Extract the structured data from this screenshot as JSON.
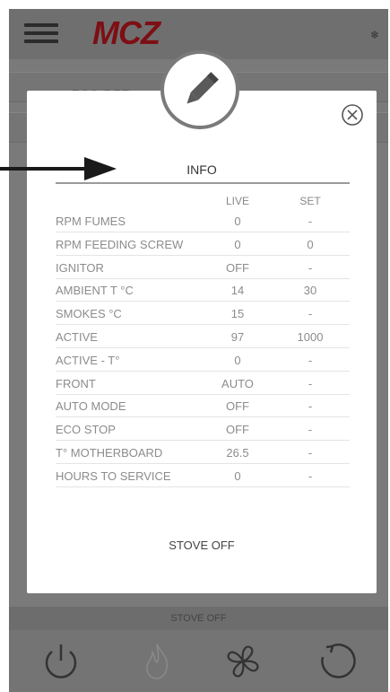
{
  "header": {
    "brand": "MCZ",
    "menu_icon": "hamburger-menu-icon",
    "status_icon": "snowflake-icon"
  },
  "background": {
    "strip_text": "ECO DET",
    "status_text": "STOVE OFF",
    "bottom_icons": [
      "power-icon",
      "flame-icon",
      "fan-icon",
      "refresh-icon"
    ]
  },
  "modal": {
    "badge_icon": "pencil-icon",
    "close_icon": "close-icon",
    "title": "INFO",
    "columns": {
      "live": "LIVE",
      "set": "SET"
    },
    "rows": [
      {
        "label": "RPM FUMES",
        "live": "0",
        "set": "-"
      },
      {
        "label": "RPM FEEDING SCREW",
        "live": "0",
        "set": "0"
      },
      {
        "label": "IGNITOR",
        "live": "OFF",
        "set": "-"
      },
      {
        "label": "AMBIENT T °C",
        "live": "14",
        "set": "30"
      },
      {
        "label": "SMOKES °C",
        "live": "15",
        "set": "-"
      },
      {
        "label": "ACTIVE",
        "live": "97",
        "set": "1000"
      },
      {
        "label": "ACTIVE - T°",
        "live": "0",
        "set": "-"
      },
      {
        "label": "FRONT",
        "live": "AUTO",
        "set": "-"
      },
      {
        "label": "AUTO MODE",
        "live": "OFF",
        "set": "-"
      },
      {
        "label": "ECO STOP",
        "live": "OFF",
        "set": "-"
      },
      {
        "label": "T° MOTHERBOARD",
        "live": "26.5",
        "set": "-"
      },
      {
        "label": "HOURS TO SERVICE",
        "live": "0",
        "set": "-"
      }
    ],
    "footer_status": "STOVE OFF"
  },
  "annotation": {
    "arrow_icon": "arrow-right-icon"
  },
  "colors": {
    "brand": "#7d0f14",
    "overlay": "#7a7a7a",
    "modal_bg": "#ffffff"
  }
}
